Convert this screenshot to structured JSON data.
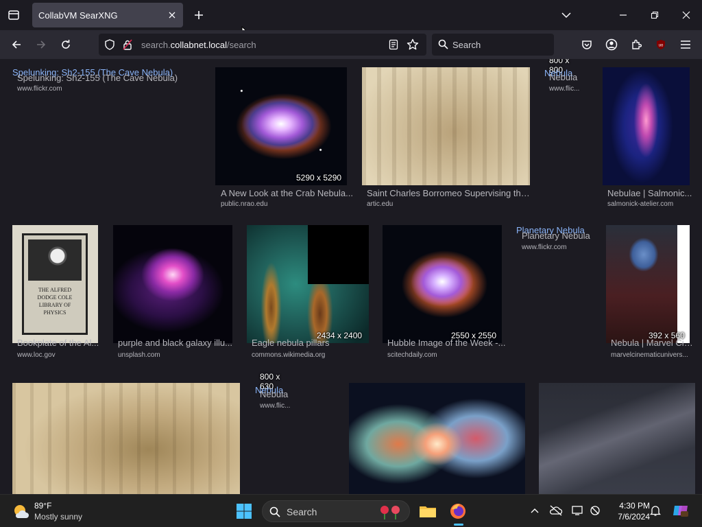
{
  "browser": {
    "tab_title": "CollabVM SearXNG",
    "url_prefix": "search.",
    "url_domain": "collabnet.local",
    "url_path": "/search",
    "search_placeholder": "Search"
  },
  "results": {
    "row1": [
      {
        "title": "Spelunking: Sh2-155 (The Cave Nebula)",
        "title_overlay": "Spelunking: Sh2-155 (The Cave Nebula)",
        "source": "www.flickr.com"
      },
      {
        "title": "A New Look at the Crab Nebula...",
        "source": "public.nrao.edu",
        "dims": "5290 x 5290"
      },
      {
        "title": "Saint Charles Borromeo Supervising the...",
        "source": "artic.edu"
      },
      {
        "title": "Nebula",
        "title_overlay": "Nebula",
        "source": "www.flic...",
        "dims": "800 x 800"
      },
      {
        "title": "Nebulae | Salmonic...",
        "source": "salmonick-atelier.com"
      }
    ],
    "row2": [
      {
        "title": "Bookplate of the Al...",
        "source": "www.loc.gov"
      },
      {
        "title": "purple and black galaxy illu...",
        "source": "unsplash.com"
      },
      {
        "title": "Eagle nebula pillars",
        "source": "commons.wikimedia.org",
        "dims": "2434 x 2400"
      },
      {
        "title": "Hubble Image of the Week -...",
        "source": "scitechdaily.com",
        "dims": "2550 x 2550"
      },
      {
        "title": "Planetary Nebula",
        "title_overlay": "Planetary Nebula",
        "source": "www.flickr.com"
      },
      {
        "title": "Nebula | Marvel Cin...",
        "source": "marvelcinematicunivers...",
        "dims": "392 x 560"
      }
    ],
    "row3": [
      {
        "title": "Nebula",
        "title_overlay": "Nebula",
        "source": "www.flic...",
        "dims": "800 x 630"
      }
    ]
  },
  "bookplate_text": "THE ALFRED DODGE COLE LIBRARY OF PHYSICS",
  "taskbar": {
    "temperature": "89°F",
    "condition": "Mostly sunny",
    "search_placeholder": "Search",
    "time": "4:30 PM",
    "date": "7/6/2024"
  },
  "colors": {
    "accent_link": "#8ab4f8",
    "tab_active": "#42414d",
    "toolbar": "#2b2a33",
    "page_bg": "#1c1b22"
  },
  "icons": [
    "tab-list-icon",
    "close-icon",
    "plus-icon",
    "chevron-down-icon",
    "minimize-icon",
    "restore-icon",
    "back-icon",
    "forward-icon",
    "reload-icon",
    "shield-icon",
    "lock-icon",
    "reader-view-icon",
    "star-icon",
    "search-icon",
    "pocket-icon",
    "account-icon",
    "extensions-icon",
    "ublock-icon",
    "menu-icon",
    "windows-start-icon",
    "file-explorer-icon",
    "firefox-icon",
    "chevron-up-icon",
    "network-icon",
    "display-icon",
    "notifications-icon",
    "copilot-icon"
  ]
}
